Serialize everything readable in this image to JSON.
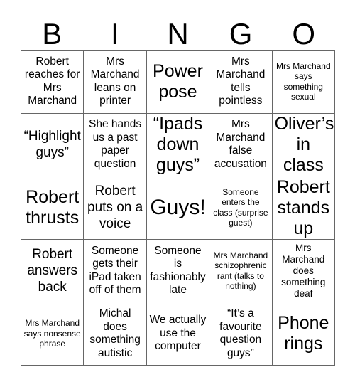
{
  "card": {
    "title": "BINGO",
    "header_letters": [
      "B",
      "I",
      "N",
      "G",
      "O"
    ],
    "grid_size": "5x5",
    "colors": {
      "background": "#ffffff",
      "text": "#000000",
      "grid_line": "#666666"
    },
    "rows": [
      [
        {
          "text": "Robert reaches for Mrs Marchand",
          "size": "sz-m"
        },
        {
          "text": "Mrs Marchand leans on printer",
          "size": "sz-m"
        },
        {
          "text": "Power pose",
          "size": "sz-xl"
        },
        {
          "text": "Mrs Marchand tells pointless",
          "size": "sz-m"
        },
        {
          "text": "Mrs Marchand says something sexual",
          "size": "sz-xs"
        }
      ],
      [
        {
          "text": "“Highlight guys”",
          "size": "sz-l"
        },
        {
          "text": "She hands us a past paper question",
          "size": "sz-m"
        },
        {
          "text": "“Ipads down guys”",
          "size": "sz-xl"
        },
        {
          "text": "Mrs Marchand false accusation",
          "size": "sz-m"
        },
        {
          "text": "Oliver’s in class",
          "size": "sz-xl"
        }
      ],
      [
        {
          "text": "Robert thrusts",
          "size": "sz-xl"
        },
        {
          "text": "Robert puts on a voice",
          "size": "sz-l"
        },
        {
          "text": "Guys!",
          "size": "sz-xxl"
        },
        {
          "text": "Someone enters the class (surprise guest)",
          "size": "sz-xs"
        },
        {
          "text": "Robert stands up",
          "size": "sz-xl"
        }
      ],
      [
        {
          "text": "Robert answers back",
          "size": "sz-l"
        },
        {
          "text": "Someone gets their iPad taken off of them",
          "size": "sz-m"
        },
        {
          "text": "Someone is fashionably late",
          "size": "sz-m"
        },
        {
          "text": "Mrs Marchand schizophrenic rant (talks to nothing)",
          "size": "sz-xs"
        },
        {
          "text": "Mrs Marchand does something deaf",
          "size": "sz-s"
        }
      ],
      [
        {
          "text": "Mrs Marchand says nonsense phrase",
          "size": "sz-xs"
        },
        {
          "text": "Michal does something autistic",
          "size": "sz-m"
        },
        {
          "text": "We actually use the computer",
          "size": "sz-m"
        },
        {
          "text": "“It’s a favourite question guys”",
          "size": "sz-m"
        },
        {
          "text": "Phone rings",
          "size": "sz-xl"
        }
      ]
    ]
  }
}
